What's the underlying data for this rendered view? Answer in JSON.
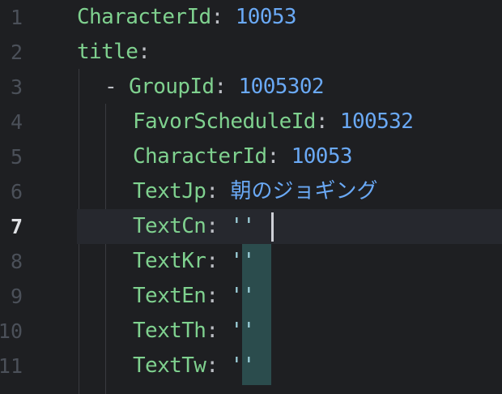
{
  "gutter": [
    "1",
    "2",
    "3",
    "4",
    "5",
    "6",
    "7",
    "8",
    "9",
    "10",
    "11"
  ],
  "lines": [
    {
      "key": "CharacterId",
      "sep": ": ",
      "value": "10053"
    },
    {
      "key": "title",
      "sep": ":",
      "value": ""
    },
    {
      "dash": "- ",
      "key": "GroupId",
      "sep": ": ",
      "value": "1005302"
    },
    {
      "key": "FavorScheduleId",
      "sep": ": ",
      "value": "100532"
    },
    {
      "key": "CharacterId",
      "sep": ": ",
      "value": "10053"
    },
    {
      "key": "TextJp",
      "sep": ": ",
      "value": "朝のジョギング"
    },
    {
      "key": "TextCn",
      "sep": ": ",
      "value": "''"
    },
    {
      "key": "TextKr",
      "sep": ": ",
      "value": "''"
    },
    {
      "key": "TextEn",
      "sep": ": ",
      "value": "''"
    },
    {
      "key": "TextTh",
      "sep": ": ",
      "value": "''"
    },
    {
      "key": "TextTw",
      "sep": ": ",
      "value": "''"
    }
  ],
  "active_line": "7",
  "colors": {
    "background": "#1e1f22",
    "current_line": "#26282e",
    "key": "#7fd18f",
    "number": "#6aa9f5",
    "string": "#9ed2dc",
    "selection": "#2b4c4d"
  }
}
